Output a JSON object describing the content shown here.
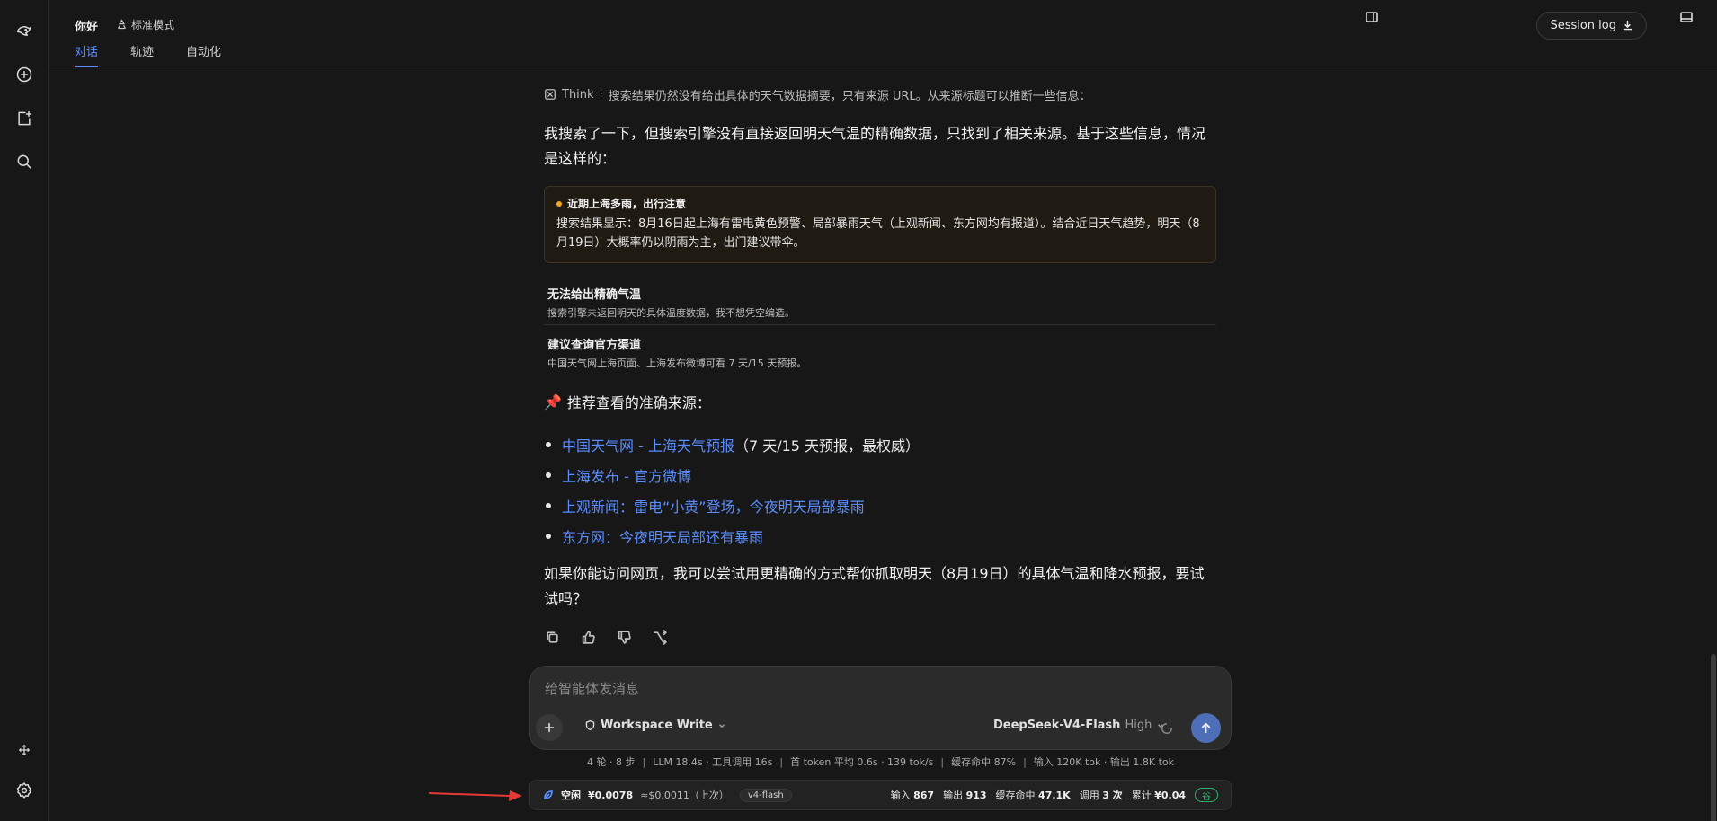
{
  "header": {
    "title": "你好",
    "mode": "标准模式",
    "tabs": [
      {
        "label": "对话",
        "active": true
      },
      {
        "label": "轨迹",
        "active": false
      },
      {
        "label": "自动化",
        "active": false
      }
    ],
    "session_log": "Session log"
  },
  "sidebar": {
    "icons": [
      "logo-icon",
      "new-chat-icon",
      "new-task-icon",
      "search-icon",
      "move-icon",
      "settings-icon"
    ]
  },
  "message": {
    "think_label": "Think",
    "think_sep": "·",
    "think_text": "搜索结果仍然没有给出具体的天气数据摘要，只有来源 URL。从来源标题可以推断一些信息：",
    "intro": "我搜索了一下，但搜索引擎没有直接返回明天气温的精确数据，只找到了相关来源。基于这些信息，情况是这样的：",
    "notice": {
      "title": "近期上海多雨，出行注意",
      "body": "搜索结果显示：8月16日起上海有雷电黄色预警、局部暴雨天气（上观新闻、东方网均有报道）。结合近日天气趋势，明天（8月19日）大概率仍以阴雨为主，出门建议带伞。"
    },
    "info_rows": [
      {
        "title": "无法给出精确气温",
        "desc": "搜索引擎未返回明天的具体温度数据，我不想凭空编造。"
      },
      {
        "title": "建议查询官方渠道",
        "desc": "中国天气网上海页面、上海发布微博可看 7 天/15 天预报。"
      }
    ],
    "sources_heading_icon": "📌",
    "sources_heading": "推荐查看的准确来源：",
    "sources": [
      {
        "link": "中国天气网 - 上海天气预报",
        "suffix": "（7 天/15 天预报，最权威）"
      },
      {
        "link": "上海发布 - 官方微博",
        "suffix": ""
      },
      {
        "link": "上观新闻：雷电“小黄”登场，今夜明天局部暴雨",
        "suffix": ""
      },
      {
        "link": "东方网：今夜明天局部还有暴雨",
        "suffix": ""
      }
    ],
    "closing": "如果你能访问网页，我可以尝试用更精确的方式帮你抓取明天（8月19日）的具体气温和降水预报，要试试吗？"
  },
  "composer": {
    "placeholder": "给智能体发消息",
    "workspace": "Workspace Write",
    "model": "DeepSeek-V4-Flash",
    "level": "High"
  },
  "stats": {
    "turns": "4 轮 · 8 步",
    "llm": "LLM 18.4s · 工具调用 16s",
    "first_token": "首 token 平均 0.6s · 139 tok/s",
    "cache": "缓存命中 87%",
    "io": "输入 120K tok · 输出 1.8K tok"
  },
  "status_bar": {
    "state": "空闲",
    "cost": "¥0.0078",
    "last": "≈$0.0011（上次）",
    "model_tag": "v4-flash",
    "input_label": "输入",
    "input_val": "867",
    "output_label": "输出",
    "output_val": "913",
    "cache_label": "缓存命中",
    "cache_val": "47.1K",
    "calls_label": "调用",
    "calls_val": "3 次",
    "total_label": "累计",
    "total_val": "¥0.04",
    "badge": "谷"
  },
  "colors": {
    "accent": "#5b8dff",
    "warning_dot": "#f5a623",
    "badge_green": "#2fb36b",
    "annotation_arrow": "#e53935"
  }
}
